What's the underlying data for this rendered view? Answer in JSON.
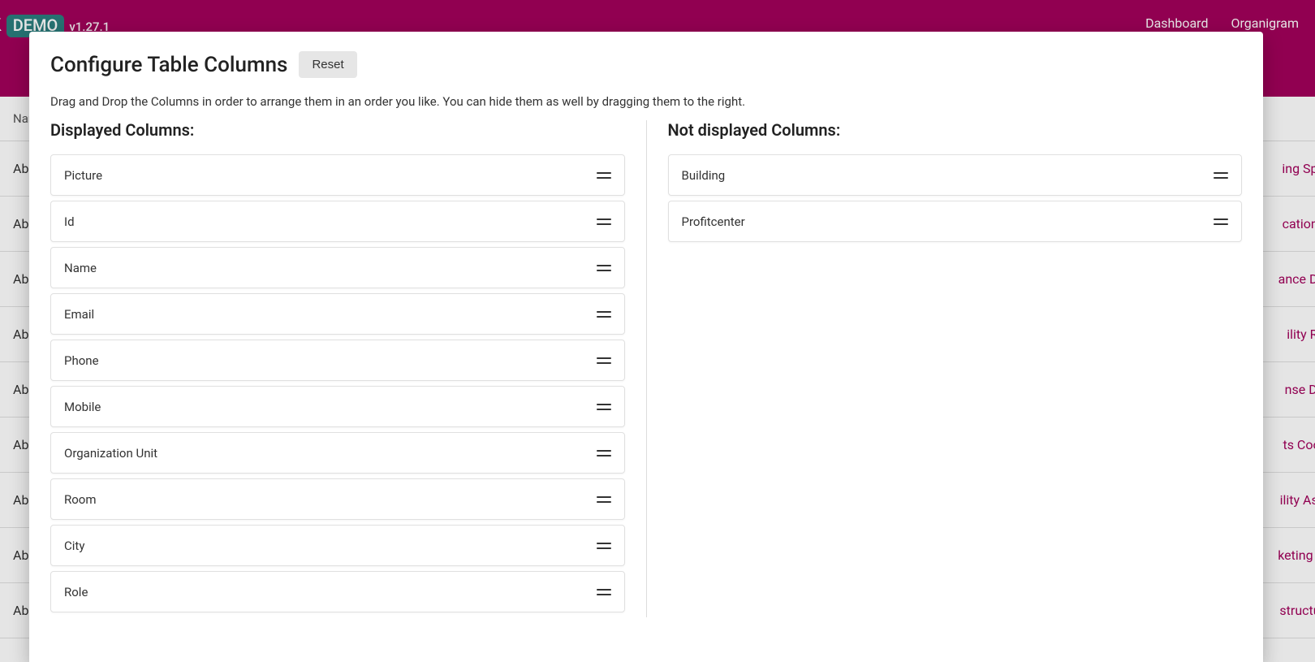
{
  "header": {
    "logo_fragment": "ook",
    "demo_badge": "DEMO",
    "version": "v1.27.1",
    "nav": [
      "Dashboard",
      "Organigram"
    ]
  },
  "bg_table": {
    "head_label": "Name",
    "rows": [
      {
        "left": "Abbo",
        "right": "ing Spe"
      },
      {
        "left": "Abbo",
        "right": "cations"
      },
      {
        "left": "Abbo",
        "right": "ance De"
      },
      {
        "left": "Abbo",
        "right": "ility Re"
      },
      {
        "left": "Aber",
        "right": "nse Dir"
      },
      {
        "left": "Aber",
        "right": "ts Coor"
      },
      {
        "left": "Absh",
        "right": "ility Ass"
      },
      {
        "left": "Absh",
        "right": "keting A"
      },
      {
        "left": "Absh",
        "right": "structur"
      }
    ]
  },
  "modal": {
    "title": "Configure Table Columns",
    "reset_label": "Reset",
    "description": "Drag and Drop the Columns in order to arrange them in an order you like. You can hide them as well by dragging them to the right.",
    "displayed_heading": "Displayed Columns:",
    "not_displayed_heading": "Not displayed Columns:",
    "displayed": [
      "Picture",
      "Id",
      "Name",
      "Email",
      "Phone",
      "Mobile",
      "Organization Unit",
      "Room",
      "City",
      "Role"
    ],
    "not_displayed": [
      "Building",
      "Profitcenter"
    ]
  }
}
